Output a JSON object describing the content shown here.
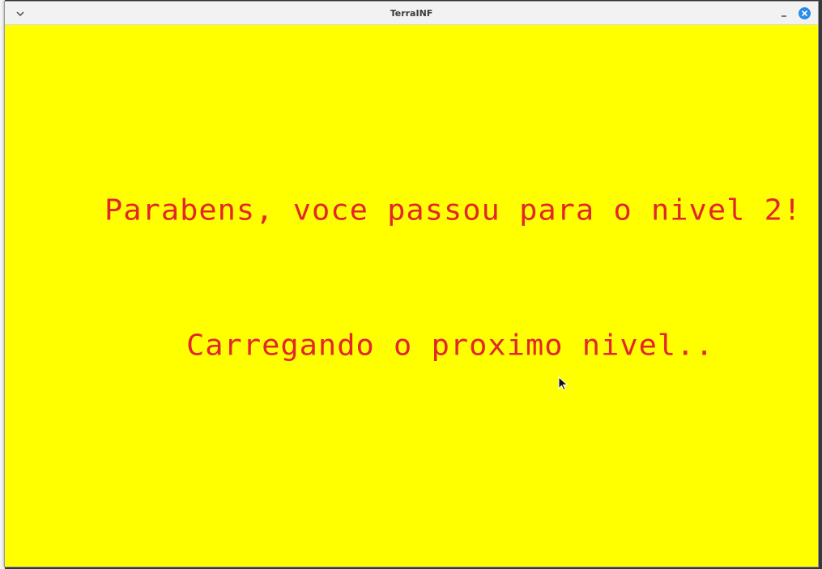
{
  "window": {
    "title": "TerraINF"
  },
  "game": {
    "message_congrats": "Parabens, voce passou para o nivel 2!",
    "message_loading": "Carregando o proximo nivel..",
    "background_color": "#ffff00",
    "text_color": "#e3262b"
  },
  "icons": {
    "menu": "chevron-down-icon",
    "minimize": "minimize-icon",
    "close": "close-icon",
    "cursor": "mouse-cursor-icon"
  }
}
